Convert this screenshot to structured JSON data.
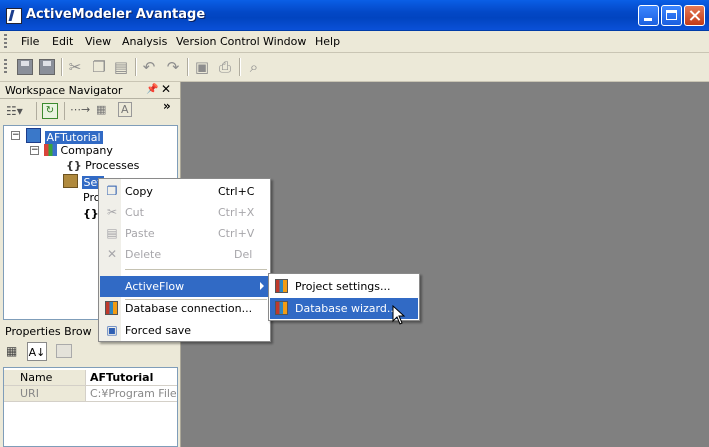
{
  "window": {
    "title": "ActiveModeler Avantage"
  },
  "menubar": {
    "items": [
      "File",
      "Edit",
      "View",
      "Analysis",
      "Version Control",
      "Window",
      "Help"
    ]
  },
  "toolbar": {
    "icons": [
      "save-icon",
      "save-all-icon",
      "cut-icon",
      "copy-icon",
      "paste-icon",
      "undo-icon",
      "redo-icon",
      "print-preview-icon",
      "print-icon",
      "search-icon"
    ]
  },
  "navigator": {
    "title": "Workspace Navigator",
    "overflow": "»",
    "tree": [
      {
        "label": "AFTutorial"
      },
      {
        "label": "Company"
      },
      {
        "label": "Processes",
        "prefix": "{}"
      },
      {
        "label": "Set",
        "prefix": ""
      },
      {
        "label": "Pro"
      },
      {
        "label": "{}"
      }
    ]
  },
  "properties": {
    "title": "Properties Brow",
    "rows": [
      {
        "name": "Name",
        "value": "AFTutorial"
      },
      {
        "name": "URI",
        "value": "C:¥Program Files¥A"
      }
    ]
  },
  "context_menu": {
    "items": [
      {
        "label": "Copy",
        "accel": "Ctrl+C",
        "enabled": true
      },
      {
        "label": "Cut",
        "accel": "Ctrl+X",
        "enabled": false
      },
      {
        "label": "Paste",
        "accel": "Ctrl+V",
        "enabled": false
      },
      {
        "label": "Delete",
        "accel": "Del",
        "enabled": false
      },
      {
        "label": "ActiveFlow",
        "submenu": true
      },
      {
        "label": "Database connection...",
        "enabled": true
      },
      {
        "label": "Forced save",
        "enabled": true
      }
    ]
  },
  "submenu": {
    "items": [
      {
        "label": "Project settings..."
      },
      {
        "label": "Database wizard..."
      }
    ]
  },
  "colors": {
    "highlight": "#316ac5",
    "workspace": "#808080",
    "title_bar": "#0348c7"
  }
}
